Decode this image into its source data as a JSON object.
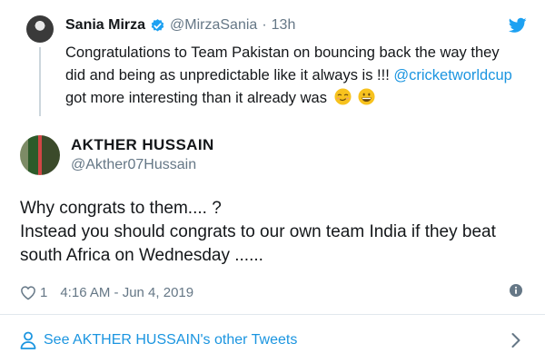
{
  "quoted_tweet": {
    "name": "Sania Mirza",
    "handle": "@MirzaSania",
    "separator": "·",
    "time": "13h",
    "text_parts": {
      "line1": "Congratulations to Team Pakistan on bouncing back the way they",
      "line2": "did and being as unpredictable like it always is !!! ",
      "mention": "@cricketworldcup",
      "line3": "got more interesting than it already was"
    },
    "emojis": [
      "smirk-face",
      "grinning-face"
    ]
  },
  "tweet": {
    "name": "AKTHER HUSSAIN",
    "handle": "@Akther07Hussain",
    "lines": [
      "Why congrats to them.... ?",
      "Instead you should congrats to our own team India if they beat",
      "south Africa on Wednesday ......"
    ],
    "like_count": "1",
    "timestamp": "4:16 AM - Jun 4, 2019"
  },
  "footer": {
    "link_text": "See AKTHER HUSSAIN's other Tweets"
  },
  "icons": {
    "verified": "verified-badge-icon",
    "twitter_bird": "twitter-bird-icon",
    "like": "heart-icon",
    "info": "info-icon",
    "profile": "profile-icon",
    "chevron": "chevron-right-icon"
  },
  "colors": {
    "brand_blue": "#1da1f2",
    "link_blue": "#1b95e0",
    "muted": "#657786",
    "text": "#14171a"
  }
}
